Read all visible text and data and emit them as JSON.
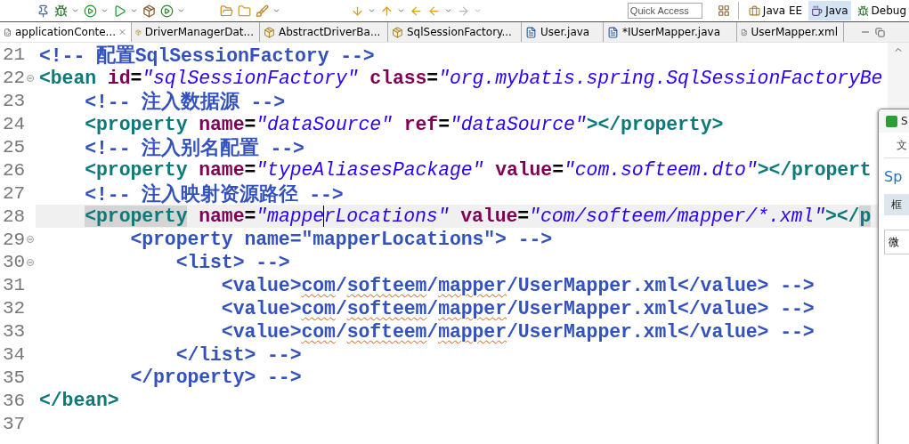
{
  "toolbar": {
    "quick_access": {
      "placeholder": "Quick Access"
    },
    "perspectives": [
      {
        "label": "Java EE",
        "selected": false
      },
      {
        "label": "Java",
        "selected": true
      },
      {
        "label": "Debug",
        "selected": false
      }
    ]
  },
  "tabs": [
    {
      "label": "applicationConte...",
      "kind": "xml",
      "selected": true
    },
    {
      "label": "DriverManagerDat...",
      "kind": "class",
      "selected": false
    },
    {
      "label": "AbstractDriverBa...",
      "kind": "class",
      "selected": false
    },
    {
      "label": "SqlSessionFactory...",
      "kind": "class",
      "selected": false
    },
    {
      "label": "User.java",
      "kind": "java",
      "selected": false
    },
    {
      "label": "*IUserMapper.java",
      "kind": "java",
      "selected": false
    },
    {
      "label": "UserMapper.xml",
      "kind": "xml",
      "selected": false
    }
  ],
  "editor": {
    "lines": [
      {
        "number": "21",
        "current": false,
        "foldable": false,
        "tokens": [
          {
            "kind": "comment",
            "text": "<!-- 配置SqlSessionFactory -->"
          }
        ]
      },
      {
        "number": "22",
        "current": false,
        "foldable": true,
        "tokens": [
          {
            "kind": "tag",
            "text": "<bean"
          },
          {
            "kind": "attr",
            "text": " id"
          },
          {
            "kind": "text",
            "text": "="
          },
          {
            "kind": "value",
            "text": "\"sqlSessionFactory\""
          },
          {
            "kind": "attr",
            "text": " class"
          },
          {
            "kind": "text",
            "text": "="
          },
          {
            "kind": "value",
            "text": "\"org.mybatis.spring.SqlSessionFactoryBe"
          }
        ]
      },
      {
        "number": "23",
        "current": false,
        "foldable": false,
        "tokens": [
          {
            "kind": "comment",
            "text": "    <!-- 注入数据源 -->"
          }
        ]
      },
      {
        "number": "24",
        "current": false,
        "foldable": false,
        "tokens": [
          {
            "kind": "tag",
            "text": "    <property"
          },
          {
            "kind": "attr",
            "text": " name"
          },
          {
            "kind": "text",
            "text": "="
          },
          {
            "kind": "value",
            "text": "\"dataSource\""
          },
          {
            "kind": "attr",
            "text": " ref"
          },
          {
            "kind": "text",
            "text": "="
          },
          {
            "kind": "value",
            "text": "\"dataSource\""
          },
          {
            "kind": "tag",
            "text": "></property>"
          }
        ]
      },
      {
        "number": "25",
        "current": false,
        "foldable": false,
        "tokens": [
          {
            "kind": "comment",
            "text": "    <!-- 注入别名配置 -->"
          }
        ]
      },
      {
        "number": "26",
        "current": false,
        "foldable": false,
        "tokens": [
          {
            "kind": "tag",
            "text": "    <property"
          },
          {
            "kind": "attr",
            "text": " name"
          },
          {
            "kind": "text",
            "text": "="
          },
          {
            "kind": "value",
            "text": "\"typeAliasesPackage\""
          },
          {
            "kind": "attr",
            "text": " value"
          },
          {
            "kind": "text",
            "text": "="
          },
          {
            "kind": "value",
            "text": "\"com.softeem.dto\""
          },
          {
            "kind": "tag",
            "text": "></propert"
          }
        ]
      },
      {
        "number": "27",
        "current": false,
        "foldable": false,
        "tokens": [
          {
            "kind": "comment",
            "text": "    <!-- 注入映射资源路径 -->"
          }
        ]
      },
      {
        "number": "28",
        "current": true,
        "foldable": false,
        "tokens": [
          {
            "kind": "tag",
            "text": "    <property",
            "marked": true
          },
          {
            "kind": "attr",
            "text": " name"
          },
          {
            "kind": "text",
            "text": "="
          },
          {
            "kind": "value",
            "text": "\"mappe"
          },
          {
            "kind": "value",
            "text": "rLocations\"",
            "caret": true
          },
          {
            "kind": "attr",
            "text": " value"
          },
          {
            "kind": "text",
            "text": "="
          },
          {
            "kind": "value",
            "text": "\"com/softeem/mapper/*.xml\""
          },
          {
            "kind": "tag",
            "text": "></"
          },
          {
            "kind": "tag",
            "text": "p",
            "marked": true
          }
        ]
      },
      {
        "number": "29",
        "current": false,
        "foldable": true,
        "tokens": [
          {
            "kind": "comment",
            "text": "        <property name=\"mapperLocations\"> -->"
          }
        ]
      },
      {
        "number": "30",
        "current": false,
        "foldable": true,
        "tokens": [
          {
            "kind": "comment",
            "text": "            <list> -->"
          }
        ]
      },
      {
        "number": "31",
        "current": false,
        "foldable": false,
        "tokens": [
          {
            "kind": "comment",
            "text": "                <value>"
          },
          {
            "kind": "misspelled",
            "text": "com"
          },
          {
            "kind": "comment",
            "text": "/"
          },
          {
            "kind": "misspelled",
            "text": "softeem"
          },
          {
            "kind": "comment",
            "text": "/"
          },
          {
            "kind": "misspelled",
            "text": "mapper"
          },
          {
            "kind": "comment",
            "text": "/UserMapper.xml</value> -->"
          }
        ]
      },
      {
        "number": "32",
        "current": false,
        "foldable": false,
        "tokens": [
          {
            "kind": "comment",
            "text": "                <value>"
          },
          {
            "kind": "misspelled",
            "text": "com"
          },
          {
            "kind": "comment",
            "text": "/"
          },
          {
            "kind": "misspelled",
            "text": "softeem"
          },
          {
            "kind": "comment",
            "text": "/"
          },
          {
            "kind": "misspelled",
            "text": "mapper"
          },
          {
            "kind": "comment",
            "text": "/UserMapper.xml</value> -->"
          }
        ]
      },
      {
        "number": "33",
        "current": false,
        "foldable": false,
        "tokens": [
          {
            "kind": "comment",
            "text": "                <value>"
          },
          {
            "kind": "misspelled",
            "text": "com"
          },
          {
            "kind": "comment",
            "text": "/"
          },
          {
            "kind": "misspelled",
            "text": "softeem"
          },
          {
            "kind": "comment",
            "text": "/"
          },
          {
            "kind": "misspelled",
            "text": "mapper"
          },
          {
            "kind": "comment",
            "text": "/UserMapper.xml</value> -->"
          }
        ]
      },
      {
        "number": "34",
        "current": false,
        "foldable": false,
        "tokens": [
          {
            "kind": "comment",
            "text": "            </list> -->"
          }
        ]
      },
      {
        "number": "35",
        "current": false,
        "foldable": false,
        "tokens": [
          {
            "kind": "comment",
            "text": "        </property> -->"
          }
        ]
      },
      {
        "number": "36",
        "current": false,
        "foldable": false,
        "tokens": [
          {
            "kind": "tag",
            "text": "</bean>"
          }
        ]
      },
      {
        "number": "37",
        "current": false,
        "foldable": false
      }
    ]
  },
  "side_window": {
    "title": "S",
    "menu": "文",
    "heading": "Sp",
    "tab": "框",
    "field": "微"
  }
}
